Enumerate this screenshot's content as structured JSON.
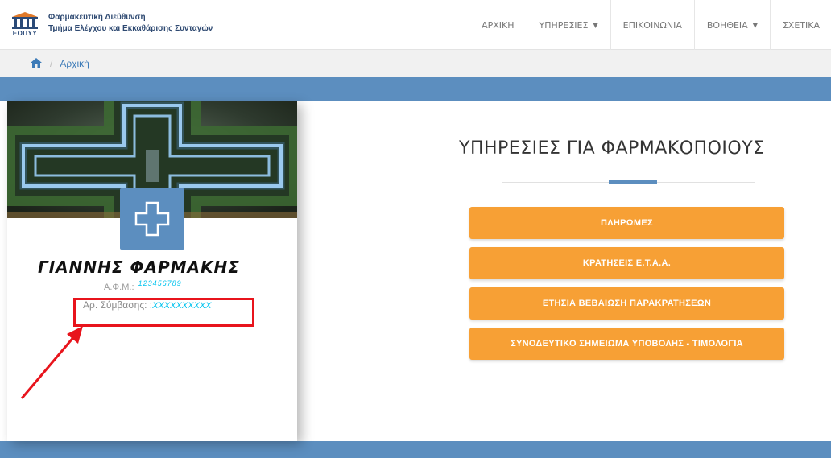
{
  "brand": {
    "logo_text": "ΕΟΠΥΥ",
    "line1": "Φαρμακευτική Διεύθυνση",
    "line2": "Τμήμα Ελέγχου και Εκκαθάρισης Συνταγών"
  },
  "nav": {
    "home": "ΑΡΧΙΚΗ",
    "services": "ΥΠΗΡΕΣΙΕΣ",
    "contact": "ΕΠΙΚΟΙΝΩΝΙΑ",
    "help": "ΒΟΗΘΕΙΑ",
    "about": "ΣΧΕΤΙΚΑ"
  },
  "breadcrumb": {
    "separator": "/",
    "current": "Αρχική"
  },
  "profile": {
    "name": "ΓΙΑΝΝΗΣ ΦΑΡΜΑΚΗΣ",
    "afm_label": "Α.Φ.Μ.:",
    "afm_value": "123456789",
    "contract_label": "Αρ. Σύμβασης: :",
    "contract_value": "XXXXXXXXXX"
  },
  "services": {
    "title": "ΥΠΗΡΕΣΙΕΣ ΓΙΑ ΦΑΡΜΑΚΟΠΟΙΟΥΣ",
    "buttons": [
      "ΠΛΗΡΩΜΕΣ",
      "ΚΡΑΤΗΣΕΙΣ Ε.Τ.Α.Α.",
      "ΕΤΗΣΙΑ ΒΕΒΑΙΩΣΗ ΠΑΡΑΚΡΑΤΗΣΕΩΝ",
      "ΣΥΝΟΔΕΥΤΙΚΟ ΣΗΜΕΙΩΜΑ ΥΠΟΒΟΛΗΣ - ΤΙΜΟΛΟΓΙΑ"
    ]
  },
  "colors": {
    "accent_blue": "#5c8ebf",
    "button_orange": "#f7a035",
    "highlight_red": "#e8141c",
    "value_cyan": "#00c3ee"
  }
}
